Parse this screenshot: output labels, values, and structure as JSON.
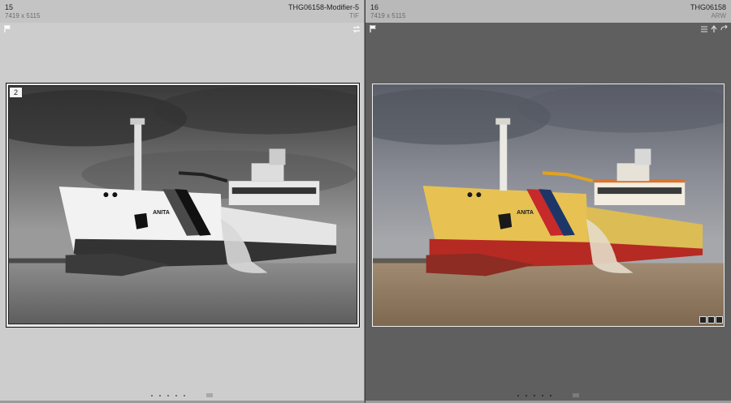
{
  "left": {
    "index": "15",
    "dimensions": "7419 x 5115",
    "filename": "THG06158-Modifier-5",
    "extension": "TIF",
    "stack_count": "2",
    "flag_icon": "flag-outline-icon",
    "sync_icon": "sync-arrows-icon",
    "style": "grayscale"
  },
  "right": {
    "index": "16",
    "dimensions": "7419 x 5115",
    "filename": "THG06158",
    "extension": "ARW",
    "flag_icon": "flag-icon",
    "menu_icon": "list-icon",
    "upload_icon": "upload-arrow-icon",
    "undo_icon": "curved-arrow-icon",
    "style": "color",
    "badges": [
      "crop-badge-icon",
      "metadata-badge-icon",
      "edited-badge-icon"
    ]
  },
  "ship": {
    "name": "ANITA"
  },
  "colors": {
    "left_bg": "#cdcdcd",
    "right_bg": "#5f5f5f",
    "hull_yellow": "#e7c253",
    "hull_red": "#b52a22",
    "stripe_blue": "#1d3668"
  }
}
